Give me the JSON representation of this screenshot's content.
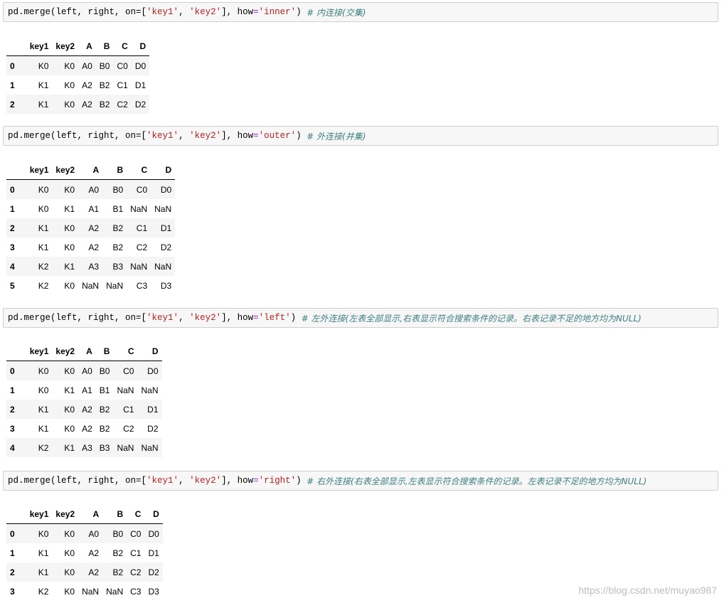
{
  "cells": [
    {
      "code": {
        "prefix": "pd.merge(left, right, on=[",
        "key1": "'key1'",
        "sep": ", ",
        "key2": "'key2'",
        "mid": "], how",
        "eq": "=",
        "how": "'inner'",
        "close": ") ",
        "comment": "# 内连接(交集)"
      },
      "table": {
        "columns": [
          "key1",
          "key2",
          "A",
          "B",
          "C",
          "D"
        ],
        "rows": [
          {
            "index": "0",
            "values": [
              "K0",
              "K0",
              "A0",
              "B0",
              "C0",
              "D0"
            ]
          },
          {
            "index": "1",
            "values": [
              "K1",
              "K0",
              "A2",
              "B2",
              "C1",
              "D1"
            ]
          },
          {
            "index": "2",
            "values": [
              "K1",
              "K0",
              "A2",
              "B2",
              "C2",
              "D2"
            ]
          }
        ]
      }
    },
    {
      "code": {
        "prefix": "pd.merge(left, right, on=[",
        "key1": "'key1'",
        "sep": ", ",
        "key2": "'key2'",
        "mid": "], how",
        "eq": "=",
        "how": "'outer'",
        "close": ") ",
        "comment": "# 外连接(并集)"
      },
      "table": {
        "columns": [
          "key1",
          "key2",
          "A",
          "B",
          "C",
          "D"
        ],
        "rows": [
          {
            "index": "0",
            "values": [
              "K0",
              "K0",
              "A0",
              "B0",
              "C0",
              "D0"
            ]
          },
          {
            "index": "1",
            "values": [
              "K0",
              "K1",
              "A1",
              "B1",
              "NaN",
              "NaN"
            ]
          },
          {
            "index": "2",
            "values": [
              "K1",
              "K0",
              "A2",
              "B2",
              "C1",
              "D1"
            ]
          },
          {
            "index": "3",
            "values": [
              "K1",
              "K0",
              "A2",
              "B2",
              "C2",
              "D2"
            ]
          },
          {
            "index": "4",
            "values": [
              "K2",
              "K1",
              "A3",
              "B3",
              "NaN",
              "NaN"
            ]
          },
          {
            "index": "5",
            "values": [
              "K2",
              "K0",
              "NaN",
              "NaN",
              "C3",
              "D3"
            ]
          }
        ]
      }
    },
    {
      "code": {
        "prefix": "pd.merge(left, right, on=[",
        "key1": "'key1'",
        "sep": ", ",
        "key2": "'key2'",
        "mid": "], how",
        "eq": "=",
        "how": "'left'",
        "close": ") ",
        "comment": "# 左外连接(左表全部显示,右表显示符合搜索条件的记录。右表记录不足的地方均为NULL)"
      },
      "table": {
        "columns": [
          "key1",
          "key2",
          "A",
          "B",
          "C",
          "D"
        ],
        "rows": [
          {
            "index": "0",
            "values": [
              "K0",
              "K0",
              "A0",
              "B0",
              "C0",
              "D0"
            ]
          },
          {
            "index": "1",
            "values": [
              "K0",
              "K1",
              "A1",
              "B1",
              "NaN",
              "NaN"
            ]
          },
          {
            "index": "2",
            "values": [
              "K1",
              "K0",
              "A2",
              "B2",
              "C1",
              "D1"
            ]
          },
          {
            "index": "3",
            "values": [
              "K1",
              "K0",
              "A2",
              "B2",
              "C2",
              "D2"
            ]
          },
          {
            "index": "4",
            "values": [
              "K2",
              "K1",
              "A3",
              "B3",
              "NaN",
              "NaN"
            ]
          }
        ]
      }
    },
    {
      "code": {
        "prefix": "pd.merge(left, right, on=[",
        "key1": "'key1'",
        "sep": ", ",
        "key2": "'key2'",
        "mid": "], how",
        "eq": "=",
        "how": "'right'",
        "close": ") ",
        "comment": "# 右外连接(右表全部显示,左表显示符合搜索条件的记录。左表记录不足的地方均为NULL)"
      },
      "table": {
        "columns": [
          "key1",
          "key2",
          "A",
          "B",
          "C",
          "D"
        ],
        "rows": [
          {
            "index": "0",
            "values": [
              "K0",
              "K0",
              "A0",
              "B0",
              "C0",
              "D0"
            ]
          },
          {
            "index": "1",
            "values": [
              "K1",
              "K0",
              "A2",
              "B2",
              "C1",
              "D1"
            ]
          },
          {
            "index": "2",
            "values": [
              "K1",
              "K0",
              "A2",
              "B2",
              "C2",
              "D2"
            ]
          },
          {
            "index": "3",
            "values": [
              "K2",
              "K0",
              "NaN",
              "NaN",
              "C3",
              "D3"
            ]
          }
        ]
      }
    }
  ],
  "watermark": "https://blog.csdn.net/muyao987",
  "colors": {
    "code_background": "#f7f7f7",
    "code_border": "#cfcfcf",
    "string": "#ba2121",
    "operator": "#aa22ff",
    "comment": "#408080",
    "row_stripe": "#f5f5f5",
    "watermark": "#bdbdbd"
  }
}
